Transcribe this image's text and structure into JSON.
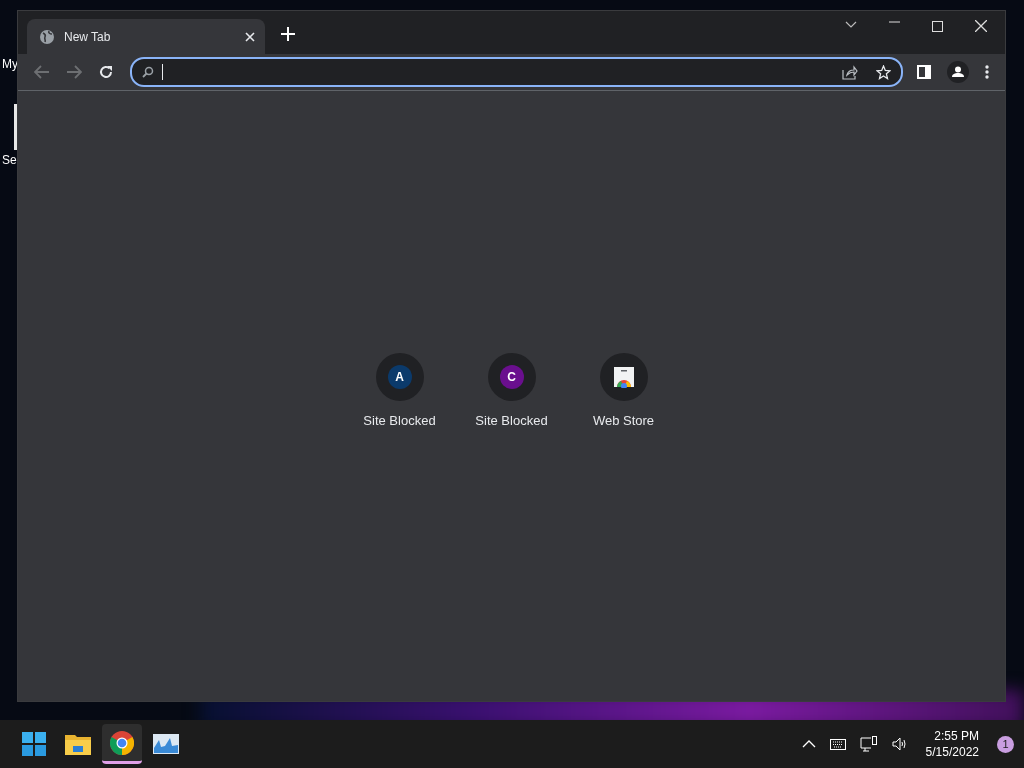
{
  "desktop_icons": [
    {
      "label": "My"
    },
    {
      "label": "Se"
    }
  ],
  "window": {
    "tabs": [
      {
        "title": "New Tab",
        "selected": true
      }
    ]
  },
  "omnibox": {
    "focused": true
  },
  "shortcuts": [
    {
      "kind": "letter",
      "letter": "A",
      "color": "#0b3a6b",
      "label": "Site Blocked"
    },
    {
      "kind": "letter",
      "letter": "C",
      "color": "#6a0f8e",
      "label": "Site Blocked"
    },
    {
      "kind": "store",
      "label": "Web Store"
    }
  ],
  "taskbar": {
    "apps": [
      {
        "kind": "start",
        "selected": false
      },
      {
        "kind": "explorer",
        "selected": false
      },
      {
        "kind": "chrome",
        "selected": true
      },
      {
        "kind": "monitor",
        "selected": false
      }
    ],
    "time": "2:55 PM",
    "date": "5/15/2022",
    "notifications": "1"
  }
}
